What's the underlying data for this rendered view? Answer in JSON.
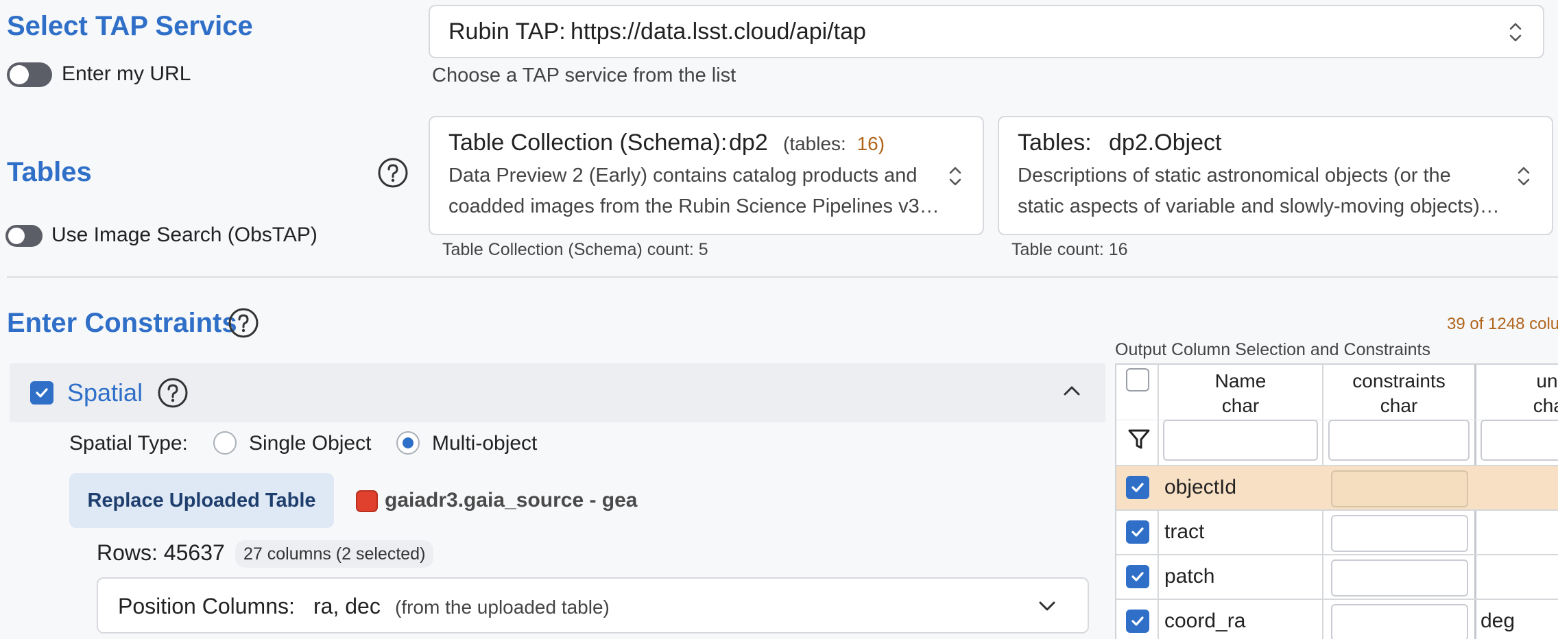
{
  "tap": {
    "title": "Select TAP Service",
    "toggle_label": "Enter my URL",
    "service_label": "Rubin TAP:",
    "service_url": "https://data.lsst.cloud/api/tap",
    "hint": "Choose a TAP service from the list"
  },
  "tables": {
    "title": "Tables",
    "image_search_label": "Use Image Search (ObsTAP)",
    "schema": {
      "label": "Table Collection (Schema):",
      "value": "dp2",
      "tables_prefix": "(tables:",
      "tables_count": "16",
      "tables_suffix": ")",
      "description_line1": "Data Preview 2 (Early) contains catalog products and",
      "description_line2": "coadded images from the Rubin Science Pipelines v3…",
      "count_note": "Table Collection (Schema) count: 5"
    },
    "table": {
      "label": "Tables:",
      "value": "dp2.Object",
      "description_line1": "Descriptions of static astronomical objects (or the",
      "description_line2": "static aspects of variable and slowly-moving objects)…",
      "count_note": "Table count: 16"
    }
  },
  "constraints": {
    "title": "Enter Constraints",
    "spatial": {
      "label": "Spatial",
      "type_label": "Spatial Type:",
      "options": [
        "Single Object",
        "Multi-object"
      ],
      "selected": "Multi-object",
      "replace_button": "Replace Uploaded Table",
      "uploaded_file": "gaiadr3.gaia_source - gea",
      "rows_label": "Rows: 45637",
      "columns_badge": "27 columns (2 selected)",
      "position_label": "Position Columns:",
      "position_value": "ra, dec",
      "position_note": "(from the uploaded table)"
    }
  },
  "output": {
    "count_text": "39 of 1248 colu",
    "title": "Output Column Selection and Constraints",
    "headers": [
      {
        "name": "Name",
        "type": "char"
      },
      {
        "name": "constraints",
        "type": "char"
      },
      {
        "name": "unit",
        "type": "char"
      }
    ],
    "rows": [
      {
        "name": "objectId",
        "unit": "",
        "highlighted": true
      },
      {
        "name": "tract",
        "unit": "",
        "highlighted": false
      },
      {
        "name": "patch",
        "unit": "",
        "highlighted": false
      },
      {
        "name": "coord_ra",
        "unit": "deg",
        "highlighted": false
      }
    ]
  },
  "colors": {
    "accent": "#2f6fc8",
    "highlight_row": "#f8e0c4",
    "tables_count": "#b0641a",
    "output_count": "#b0641a",
    "file_badge": "#e0412e"
  }
}
